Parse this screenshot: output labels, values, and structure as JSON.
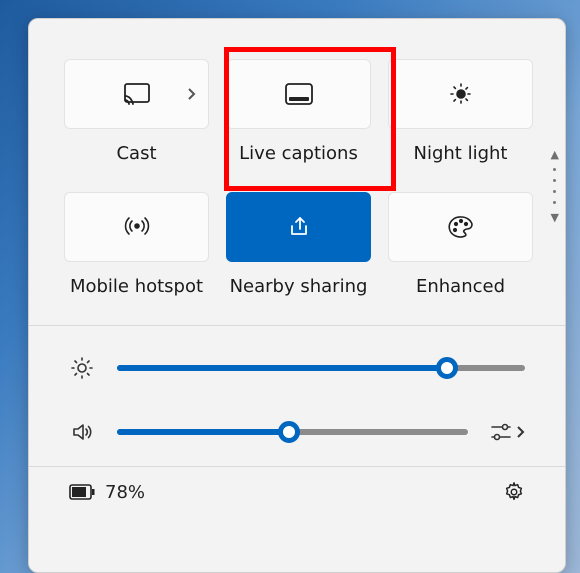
{
  "tiles": [
    {
      "id": "cast",
      "label": "Cast",
      "active": false,
      "icon": "cast",
      "hasChevron": true
    },
    {
      "id": "live-captions",
      "label": "Live captions",
      "active": false,
      "icon": "captions",
      "hasChevron": false,
      "highlighted": true
    },
    {
      "id": "night-light",
      "label": "Night light",
      "active": false,
      "icon": "nightlight",
      "hasChevron": false
    },
    {
      "id": "mobile-hotspot",
      "label": "Mobile hotspot",
      "active": false,
      "icon": "hotspot",
      "hasChevron": false
    },
    {
      "id": "nearby-sharing",
      "label": "Nearby sharing",
      "active": true,
      "icon": "share",
      "hasChevron": false
    },
    {
      "id": "enhanced",
      "label": "Enhanced",
      "active": false,
      "icon": "palette",
      "hasChevron": false
    }
  ],
  "sliders": {
    "brightness": {
      "value": 81
    },
    "volume": {
      "value": 49
    }
  },
  "footer": {
    "battery_text": "78%"
  },
  "colors": {
    "accent": "#0067c0",
    "highlight": "#ff0000"
  }
}
